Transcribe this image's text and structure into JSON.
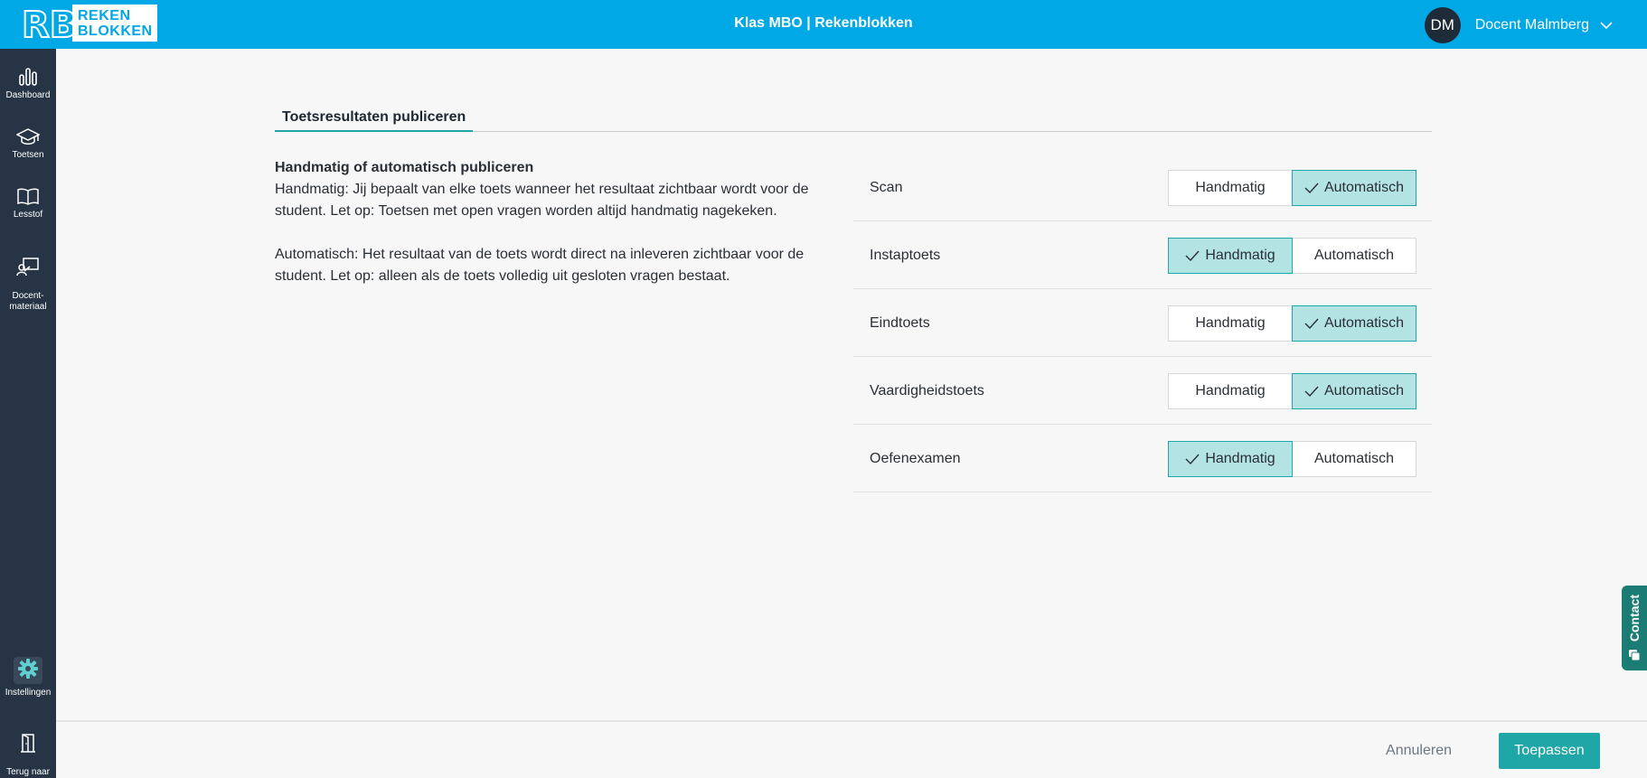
{
  "header": {
    "logo_line1": "REKEN",
    "logo_line2": "BLOKKEN",
    "title": "Klas MBO | Rekenblokken",
    "user_initials": "DM",
    "user_name": "Docent Malmberg"
  },
  "sidebar": {
    "items": [
      {
        "label": "Dashboard",
        "icon": "bar-chart-icon"
      },
      {
        "label": "Toetsen",
        "icon": "graduation-cap-icon"
      },
      {
        "label": "Lesstof",
        "icon": "book-icon"
      },
      {
        "label": "Docent-\nmateriaal",
        "icon": "teacher-board-icon"
      },
      {
        "label": "Instellingen",
        "icon": "gear-icon"
      },
      {
        "label": "Terug naar\nklassen",
        "icon": "door-icon"
      }
    ]
  },
  "main": {
    "tab": "Toetsresultaten publiceren",
    "description": {
      "heading": "Handmatig of automatisch publiceren",
      "manual": "Handmatig: Jij bepaalt van elke toets wanneer het resultaat zichtbaar wordt voor de student. Let op: Toetsen met open vragen worden altijd handmatig nagekeken.",
      "automatic": "Automatisch: Het resultaat van de toets wordt direct na inleveren zichtbaar voor de student. Let op: alleen als de toets volledig uit gesloten vragen bestaat."
    },
    "options": {
      "manual": "Handmatig",
      "automatic": "Automatisch"
    },
    "rows": [
      {
        "label": "Scan",
        "selected": "automatic"
      },
      {
        "label": "Instaptoets",
        "selected": "manual"
      },
      {
        "label": "Eindtoets",
        "selected": "automatic"
      },
      {
        "label": "Vaardigheidstoets",
        "selected": "automatic"
      },
      {
        "label": "Oefenexamen",
        "selected": "manual"
      }
    ]
  },
  "footer": {
    "cancel": "Annuleren",
    "apply": "Toepassen"
  },
  "contact": {
    "label": "Contact"
  },
  "colors": {
    "header": "#00a8e6",
    "sidebar": "#263445",
    "accent": "#1ea7a6",
    "selected_bg": "#b3e3e3"
  }
}
